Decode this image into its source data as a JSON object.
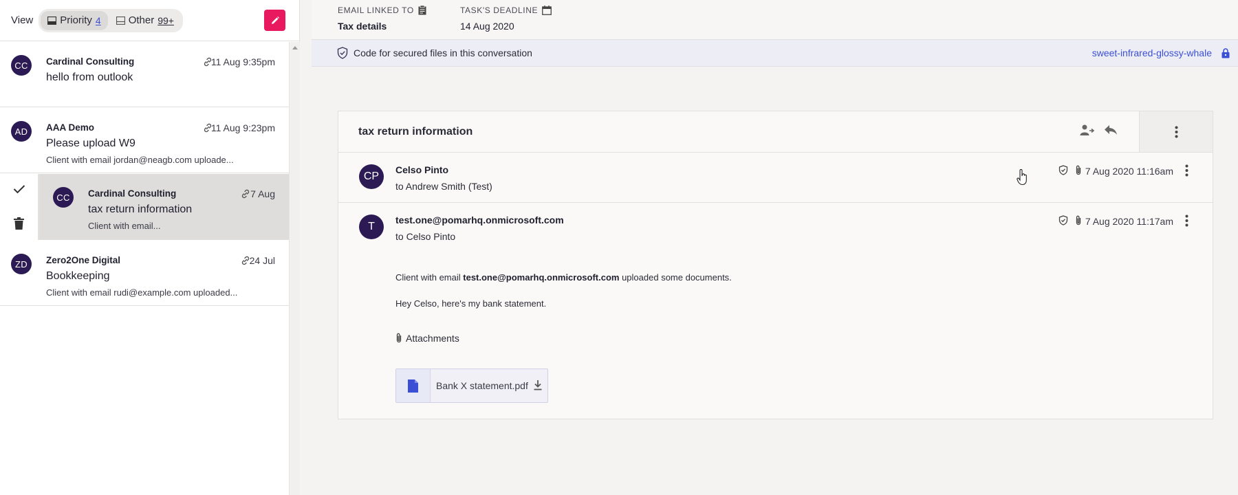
{
  "left": {
    "view_label": "View",
    "tabs": [
      {
        "label": "Priority",
        "count": "4"
      },
      {
        "label": "Other",
        "count": "99+"
      }
    ],
    "items": [
      {
        "initials": "CC",
        "sender": "Cardinal Consulting",
        "time": "11 Aug 9:35pm",
        "subject": "hello from outlook",
        "preview": ""
      },
      {
        "initials": "AD",
        "sender": "AAA Demo",
        "time": "11 Aug 9:23pm",
        "subject": "Please upload W9",
        "preview": "Client with email jordan@neagb.com uploade..."
      },
      {
        "initials": "CC",
        "sender": "Cardinal Consulting",
        "time": "7 Aug",
        "subject": "tax return information",
        "preview": "Client with email..."
      },
      {
        "initials": "ZD",
        "sender": "Zero2One Digital",
        "time": "24 Jul",
        "subject": "Bookkeeping",
        "preview": "Client with email rudi@example.com uploaded..."
      }
    ]
  },
  "meta": {
    "email_linked_label": "EMAIL LINKED TO",
    "email_linked_value": "Tax details",
    "deadline_label": "TASK'S DEADLINE",
    "deadline_value": "14 Aug 2020"
  },
  "secure": {
    "text": "Code for secured files in this conversation",
    "code": "sweet-infrared-glossy-whale"
  },
  "thread": {
    "title": "tax return information",
    "messages": [
      {
        "initials": "CP",
        "from": "Celso Pinto",
        "to": "to Andrew Smith (Test)",
        "date": "7 Aug 2020 11:16am"
      },
      {
        "initials": "T",
        "from": "test.one@pomarhq.onmicrosoft.com",
        "to": "to Celso Pinto",
        "date": "7 Aug 2020 11:17am",
        "body_prefix": "Client with email ",
        "body_email": "test.one@pomarhq.onmicrosoft.com",
        "body_suffix": " uploaded some documents.",
        "body_line2": "Hey Celso, here's my bank statement.",
        "attachments_label": "Attachments",
        "attachment_name": "Bank X statement.pdf"
      }
    ]
  },
  "colors": {
    "accent": "#e8195e",
    "avatar": "#2c1a55",
    "link": "#3b4fd6"
  }
}
